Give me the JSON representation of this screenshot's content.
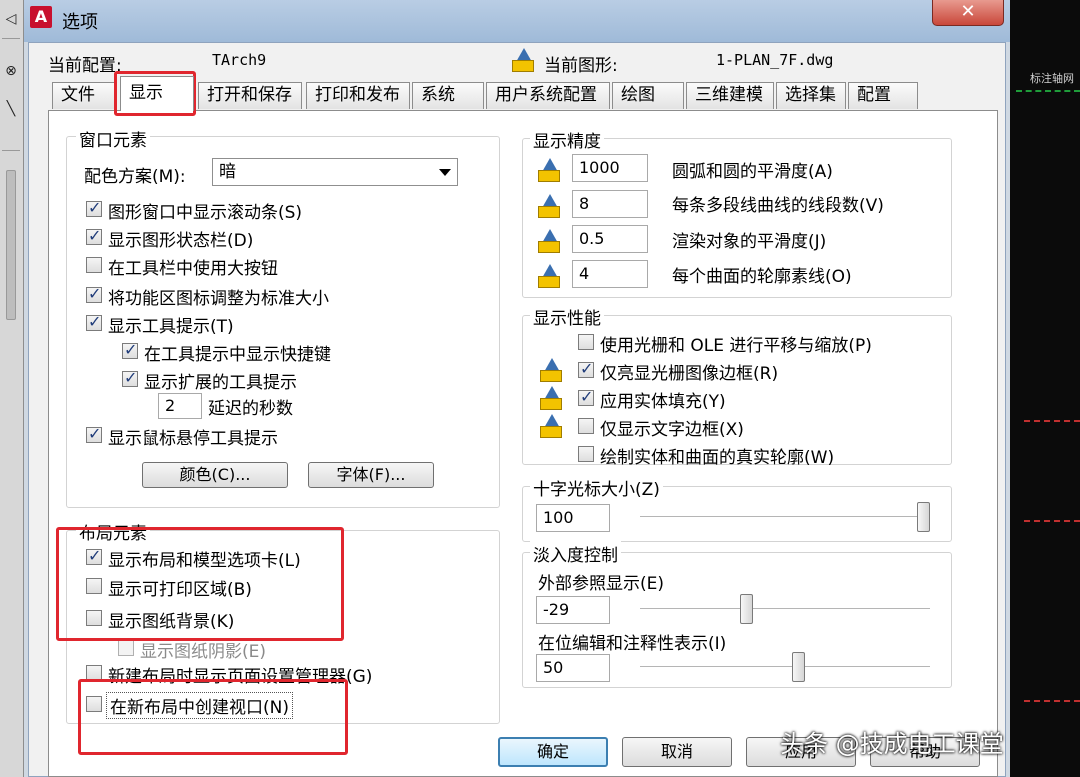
{
  "window": {
    "title": "选项",
    "close_glyph": "✕",
    "app_icon_glyph": "A"
  },
  "header": {
    "profile_label": "当前配置:",
    "profile_value": "TArch9",
    "drawing_label": "当前图形:",
    "drawing_value": "1-PLAN_7F.dwg"
  },
  "tabs": [
    "文件",
    "显示",
    "打开和保存",
    "打印和发布",
    "系统",
    "用户系统配置",
    "绘图",
    "三维建模",
    "选择集",
    "配置"
  ],
  "window_elements": {
    "title": "窗口元素",
    "color_scheme_label": "配色方案(M):",
    "color_scheme_value": "暗",
    "checkboxes": [
      {
        "label": "图形窗口中显示滚动条(S)",
        "checked": true
      },
      {
        "label": "显示图形状态栏(D)",
        "checked": true
      },
      {
        "label": "在工具栏中使用大按钮",
        "checked": false
      },
      {
        "label": "将功能区图标调整为标准大小",
        "checked": true
      },
      {
        "label": "显示工具提示(T)",
        "checked": true
      },
      {
        "label": "在工具提示中显示快捷键",
        "checked": true
      },
      {
        "label": "显示扩展的工具提示",
        "checked": true
      },
      {
        "label": "显示鼠标悬停工具提示",
        "checked": true
      }
    ],
    "delay_value": "2",
    "delay_label": "延迟的秒数",
    "colors_button": "颜色(C)...",
    "fonts_button": "字体(F)..."
  },
  "layout_elements": {
    "title": "布局元素",
    "checkboxes": [
      {
        "label": "显示布局和模型选项卡(L)",
        "checked": true
      },
      {
        "label": "显示可打印区域(B)",
        "checked": false
      },
      {
        "label": "显示图纸背景(K)",
        "checked": false
      },
      {
        "label": "显示图纸阴影(E)",
        "checked": false
      },
      {
        "label": "新建布局时显示页面设置管理器(G)",
        "checked": false
      },
      {
        "label": "在新布局中创建视口(N)",
        "checked": false
      }
    ]
  },
  "display_resolution": {
    "title": "显示精度",
    "rows": [
      {
        "value": "1000",
        "label": "圆弧和圆的平滑度(A)"
      },
      {
        "value": "8",
        "label": "每条多段线曲线的线段数(V)"
      },
      {
        "value": "0.5",
        "label": "渲染对象的平滑度(J)"
      },
      {
        "value": "4",
        "label": "每个曲面的轮廓素线(O)"
      }
    ]
  },
  "display_performance": {
    "title": "显示性能",
    "checkboxes": [
      {
        "label": "使用光栅和 OLE 进行平移与缩放(P)",
        "checked": false
      },
      {
        "label": "仅亮显光栅图像边框(R)",
        "checked": true
      },
      {
        "label": "应用实体填充(Y)",
        "checked": true
      },
      {
        "label": "仅显示文字边框(X)",
        "checked": false
      },
      {
        "label": "绘制实体和曲面的真实轮廓(W)",
        "checked": false
      }
    ]
  },
  "crosshair": {
    "title": "十字光标大小(Z)",
    "value": "100",
    "level": 100
  },
  "fade_control": {
    "title": "淡入度控制",
    "xref_label": "外部参照显示(E)",
    "xref_value": "-29",
    "xref_level": 0.36,
    "inplace_label": "在位编辑和注释性表示(I)",
    "inplace_value": "50",
    "inplace_level": 0.55
  },
  "buttons": {
    "ok": "确定",
    "cancel": "取消",
    "apply": "应用",
    "help": "帮助"
  },
  "watermark": "头条 @技成电工课堂",
  "cad_text": "标注轴网"
}
